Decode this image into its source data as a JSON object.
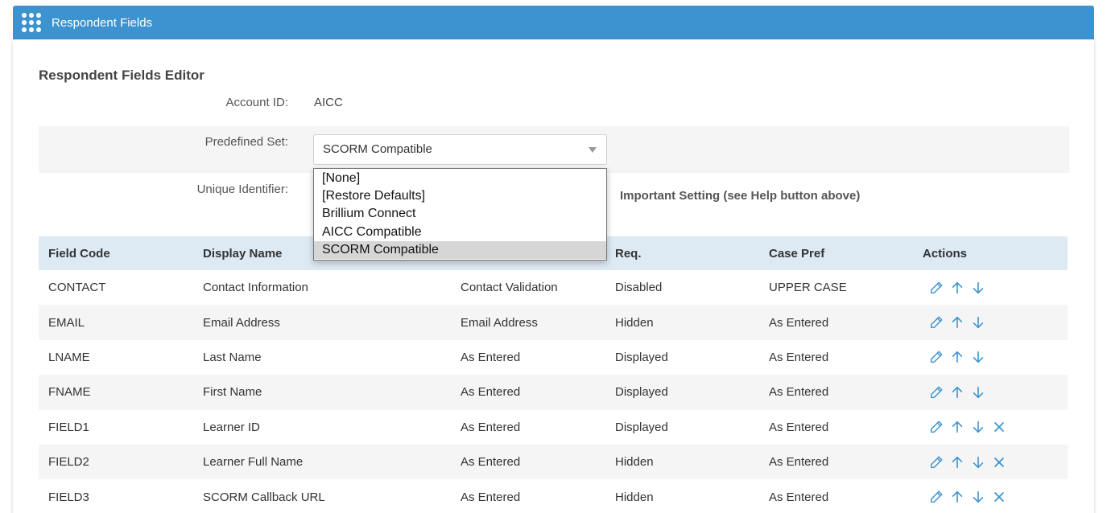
{
  "header": {
    "title": "Respondent Fields",
    "menu_icon": "apps-grid-icon"
  },
  "editor": {
    "title": "Respondent Fields Editor",
    "account_id_label": "Account ID:",
    "account_id_value": "AICC",
    "predefined_set_label": "Predefined Set:",
    "predefined_set_value": "SCORM Compatible",
    "unique_identifier_label": "Unique Identifier:",
    "important_note": "Important Setting (see Help button above)"
  },
  "dropdown": {
    "options": [
      "[None]",
      "[Restore Defaults]",
      "Brillium Connect",
      "AICC Compatible",
      "SCORM Compatible"
    ],
    "selected": "SCORM Compatible"
  },
  "table": {
    "headers": [
      "Field Code",
      "Display Name",
      "",
      "Req.",
      "Case Pref",
      "Actions"
    ],
    "rows": [
      {
        "code": "CONTACT",
        "name": "Contact Information",
        "validation": "Contact Validation",
        "req": "Disabled",
        "case": "UPPER CASE",
        "deletable": false
      },
      {
        "code": "EMAIL",
        "name": "Email Address",
        "validation": "Email Address",
        "req": "Hidden",
        "case": "As Entered",
        "deletable": false
      },
      {
        "code": "LNAME",
        "name": "Last Name",
        "validation": "As Entered",
        "req": "Displayed",
        "case": "As Entered",
        "deletable": false
      },
      {
        "code": "FNAME",
        "name": "First Name",
        "validation": "As Entered",
        "req": "Displayed",
        "case": "As Entered",
        "deletable": false
      },
      {
        "code": "FIELD1",
        "name": "Learner ID",
        "validation": "As Entered",
        "req": "Displayed",
        "case": "As Entered",
        "deletable": true
      },
      {
        "code": "FIELD2",
        "name": "Learner Full Name",
        "validation": "As Entered",
        "req": "Hidden",
        "case": "As Entered",
        "deletable": true
      },
      {
        "code": "FIELD3",
        "name": "SCORM Callback URL",
        "validation": "As Entered",
        "req": "Hidden",
        "case": "As Entered",
        "deletable": true
      }
    ]
  },
  "colors": {
    "header_bar": "#3d93cf",
    "table_header": "#dde9f3",
    "action_icon": "#3d93cf"
  }
}
